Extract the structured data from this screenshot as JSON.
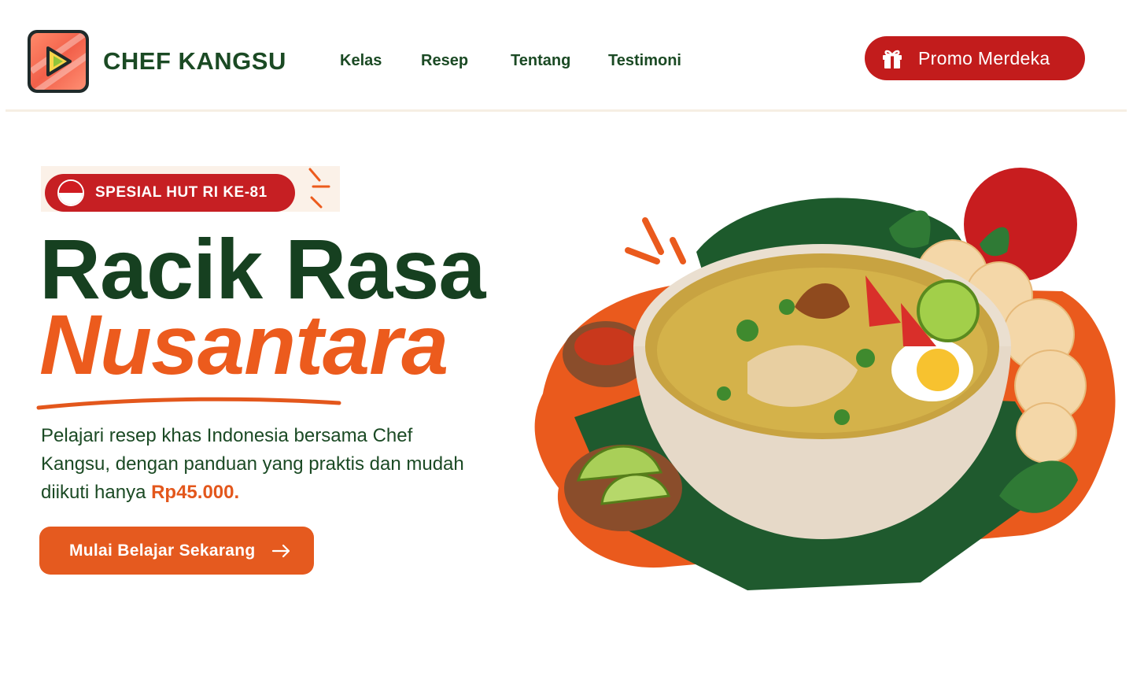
{
  "brand": {
    "name": "CHEF KANGSU",
    "logo_icon": "play-icon"
  },
  "nav": {
    "items": [
      {
        "label": "Kelas"
      },
      {
        "label": "Resep"
      },
      {
        "label": "Tentang"
      },
      {
        "label": "Testimoni"
      }
    ]
  },
  "promo": {
    "label": "Promo Merdeka",
    "icon": "gift-icon"
  },
  "hero": {
    "badge": "SPESIAL HUT RI KE-81",
    "headline_line1": "Racik Rasa",
    "headline_line2": "Nusantara",
    "description_prefix": "Pelajari resep khas Indonesia bersama Chef Kangsu, dengan panduan yang praktis dan mudah diikuti hanya ",
    "price": "Rp45.000.",
    "cta_label": "Mulai Belajar Sekarang",
    "cta_icon": "arrow-right-icon"
  },
  "colors": {
    "brand_green": "#164020",
    "accent_orange": "#ec5b1d",
    "promo_red": "#c21c1c",
    "badge_red": "#c61f23"
  }
}
